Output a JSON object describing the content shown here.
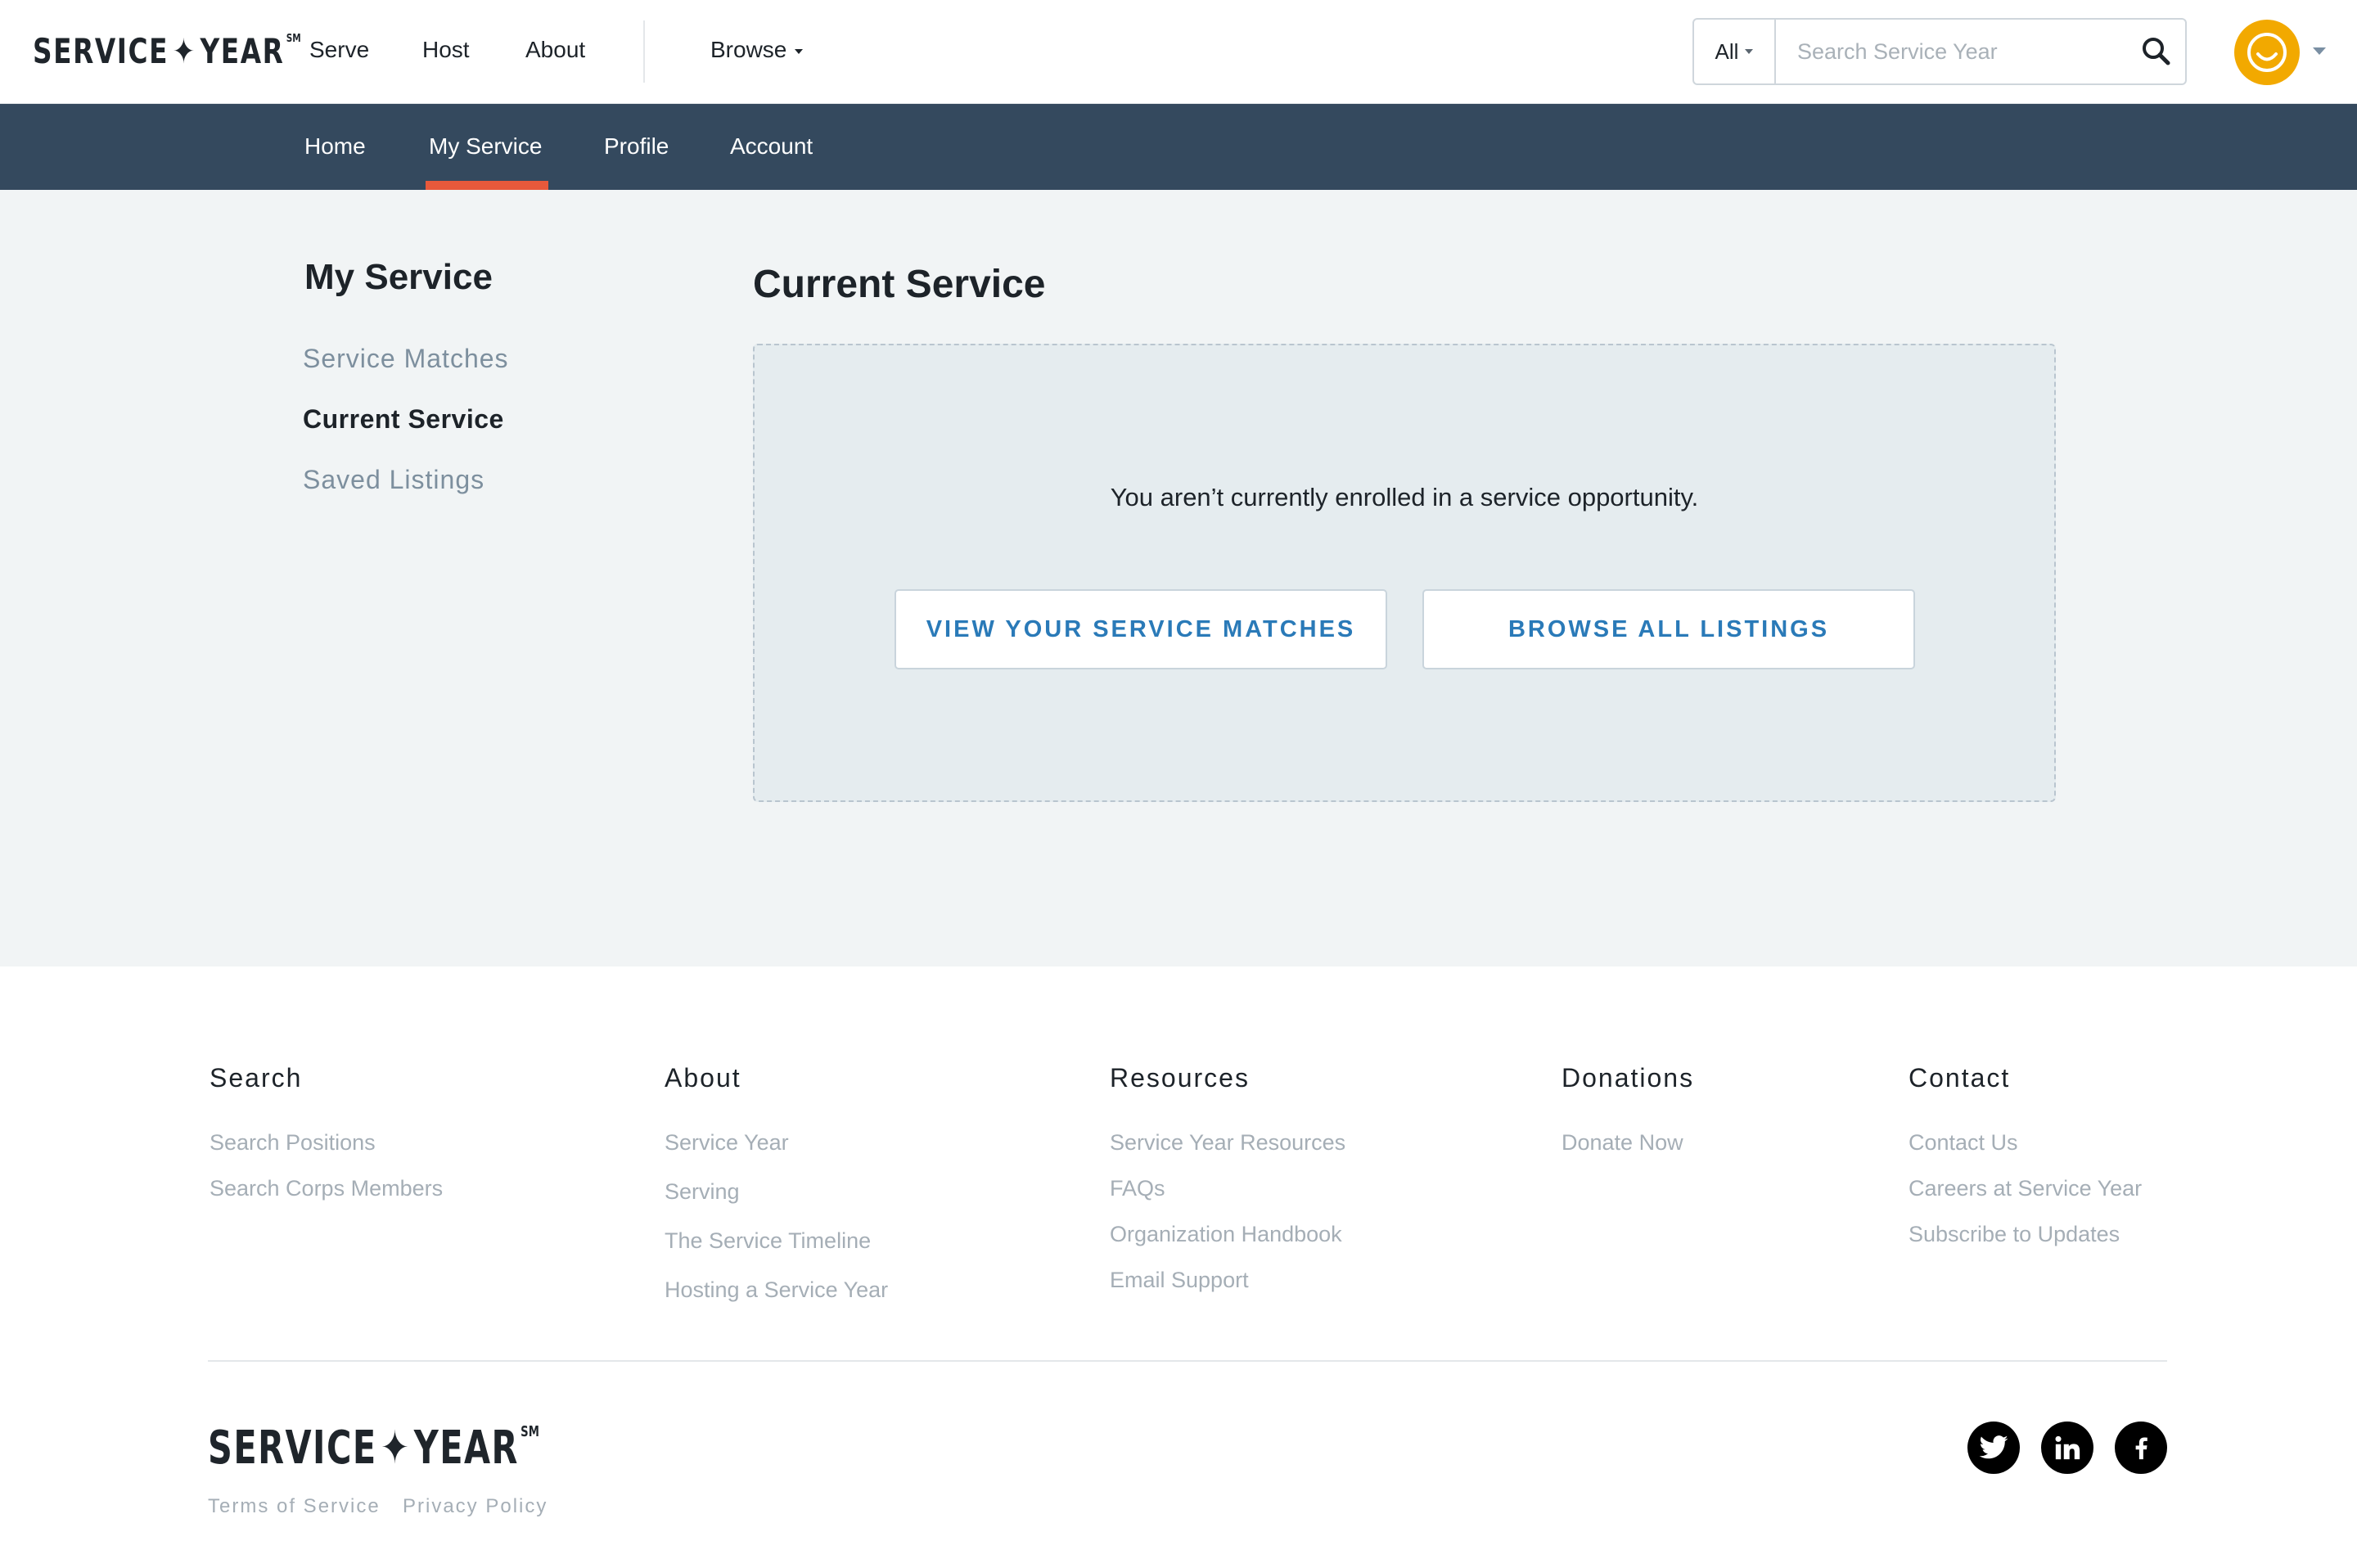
{
  "brand": {
    "logo_left": "SERVICE",
    "logo_star": "✦",
    "logo_right": "YEAR",
    "logo_mark": "SM"
  },
  "header": {
    "nav": [
      "Serve",
      "Host",
      "About"
    ],
    "browse_label": "Browse",
    "search": {
      "scope": "All",
      "placeholder": "Search Service Year"
    }
  },
  "subnav": {
    "items": [
      "Home",
      "My Service",
      "Profile",
      "Account"
    ],
    "active": "My Service"
  },
  "sidebar": {
    "title": "My Service",
    "items": [
      "Service Matches",
      "Current Service",
      "Saved Listings"
    ],
    "active": "Current Service"
  },
  "main": {
    "title": "Current Service",
    "empty_message": "You aren’t currently enrolled in a service opportunity.",
    "primary_button": "VIEW YOUR SERVICE MATCHES",
    "secondary_button": "BROWSE ALL LISTINGS"
  },
  "footer": {
    "columns": [
      {
        "heading": "Search",
        "links": [
          "Search Positions",
          "Search Corps Members"
        ]
      },
      {
        "heading": "About",
        "links": [
          "Service Year",
          "Serving",
          "The Service Timeline",
          "Hosting a Service Year"
        ]
      },
      {
        "heading": "Resources",
        "links": [
          "Service Year Resources",
          "FAQs",
          "Organization Handbook",
          "Email Support"
        ]
      },
      {
        "heading": "Donations",
        "links": [
          "Donate Now"
        ]
      },
      {
        "heading": "Contact",
        "links": [
          "Contact Us",
          "Careers at Service Year",
          "Subscribe to Updates"
        ]
      }
    ],
    "legal": [
      "Terms of Service",
      "Privacy Policy"
    ],
    "social": [
      "twitter-icon",
      "linkedin-icon",
      "facebook-icon"
    ]
  },
  "colors": {
    "subnav_bg": "#34495e",
    "active_indicator": "#e8593b",
    "link_blue": "#2a7ab8",
    "avatar": "#f2a900",
    "page_bg": "#f1f4f5"
  }
}
